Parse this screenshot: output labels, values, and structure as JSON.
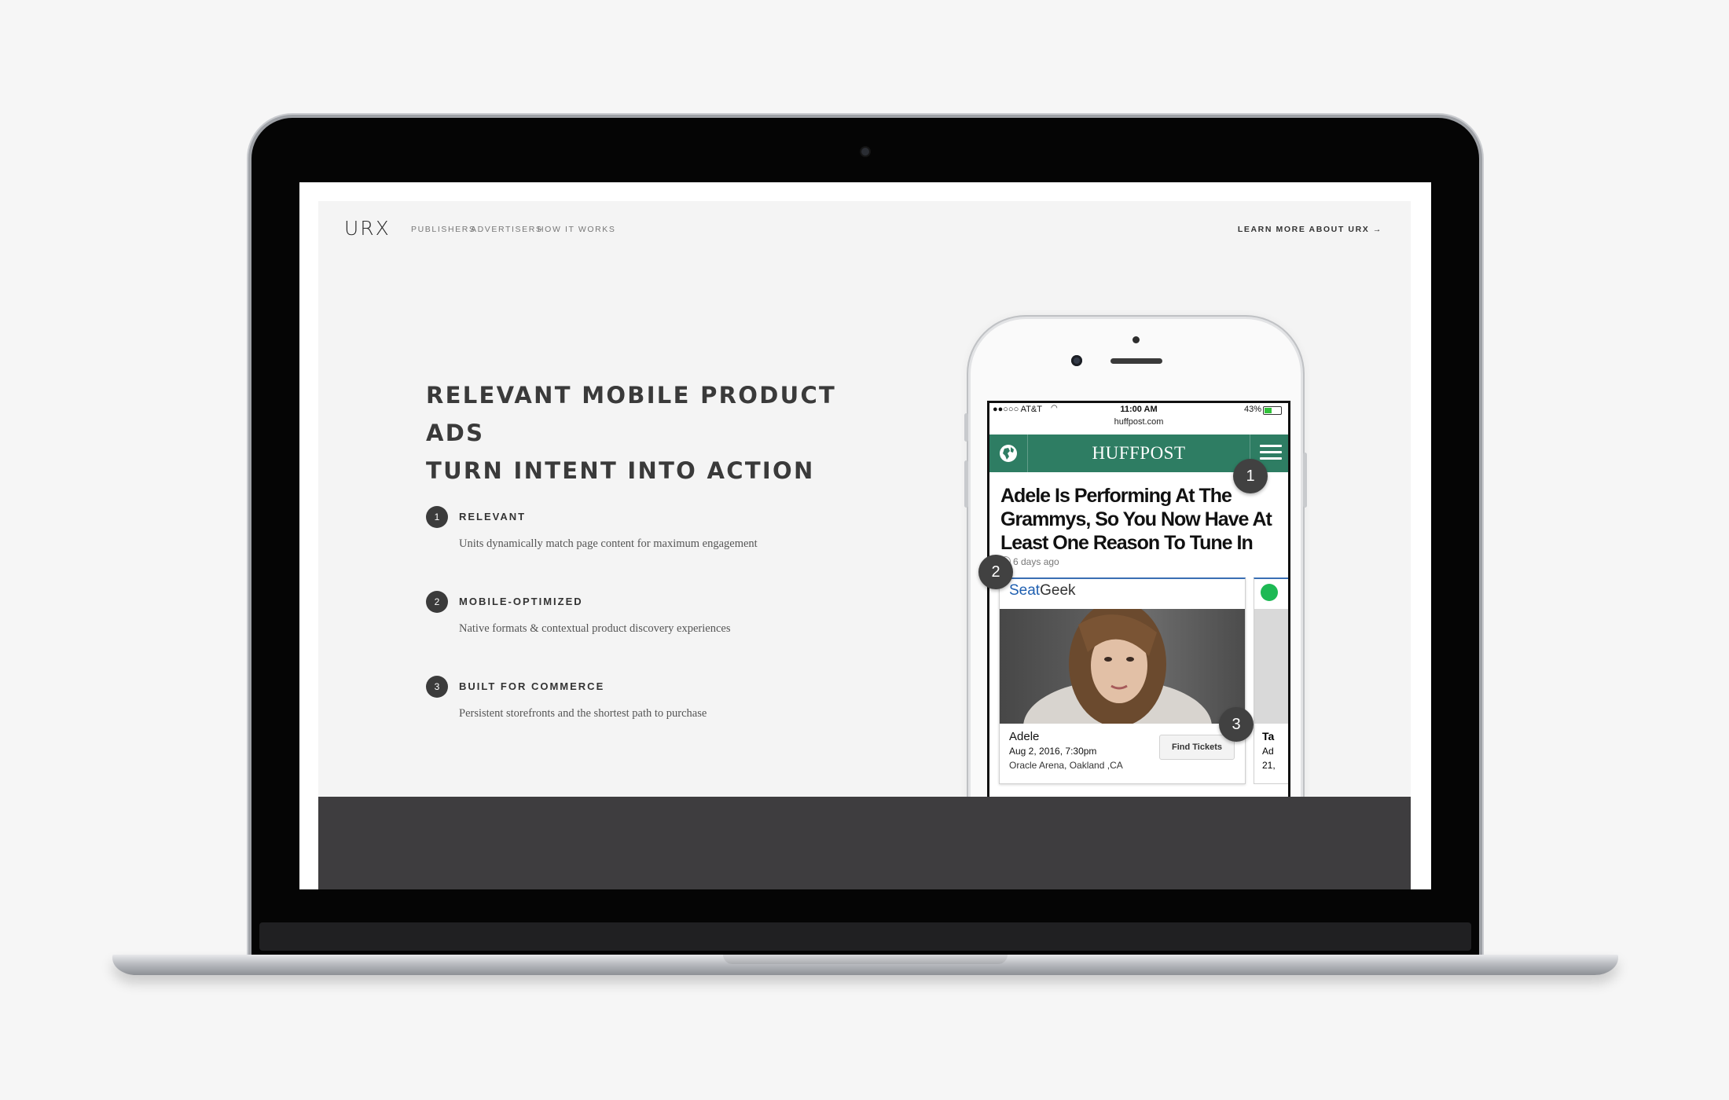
{
  "nav": {
    "logo": "URX",
    "links": [
      "PUBLISHERS",
      "ADVERTISERS",
      "HOW IT WORKS"
    ],
    "cta": "LEARN MORE ABOUT URX →"
  },
  "hero": {
    "headline_line1": "RELEVANT MOBILE PRODUCT ADS",
    "headline_line2": "TURN INTENT INTO ACTION"
  },
  "features": [
    {
      "number": "1",
      "title": "RELEVANT",
      "description": "Units dynamically match page content for maximum engagement"
    },
    {
      "number": "2",
      "title": "MOBILE-OPTIMIZED",
      "description": "Native formats & contextual product discovery experiences"
    },
    {
      "number": "3",
      "title": "BUILT FOR COMMERCE",
      "description": "Persistent storefronts and the shortest path to purchase"
    }
  ],
  "phone": {
    "carrier": "●●○○○ AT&T",
    "time": "11:00 AM",
    "battery": "43%",
    "url": "huffpost.com",
    "site_logo": "HUFFPOST",
    "article_title": "Adele Is Performing At The Grammys, So You Now Have At Least One Reason To Tune In",
    "article_age": "6 days ago",
    "ad": {
      "brand_a": "Seat",
      "brand_b": "Geek",
      "name": "Adele",
      "date": "Aug 2, 2016, 7:30pm",
      "venue": "Oracle Arena, Oakland ,CA",
      "button": "Find Tickets"
    },
    "ad2_partial": {
      "line1": "Ta",
      "line2": "Ad",
      "line3": "21,"
    },
    "badges": [
      "1",
      "2",
      "3"
    ]
  },
  "colors": {
    "huffpost_green": "#2e7d63",
    "seatgeek_blue": "#1f5fb0",
    "dark_band": "#3e3d3f"
  }
}
